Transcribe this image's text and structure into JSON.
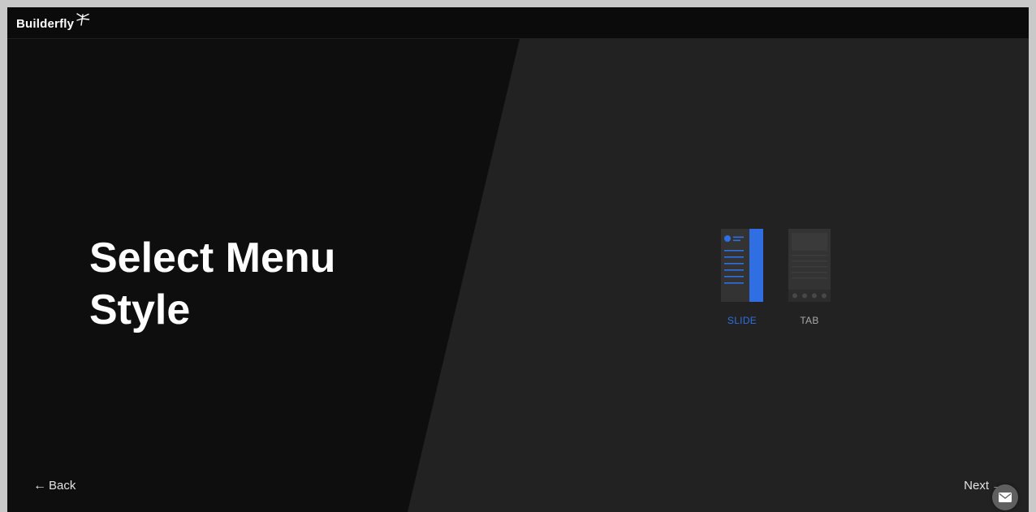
{
  "header": {
    "logo_text": "Builderfly",
    "logo_icon": "dragonfly-icon"
  },
  "main": {
    "heading_line1": "Select Menu",
    "heading_line2": "Style",
    "options": [
      {
        "label": "SLIDE",
        "icon": "slide-menu-icon",
        "selected": true
      },
      {
        "label": "TAB",
        "icon": "tab-menu-icon",
        "selected": false
      }
    ]
  },
  "footer": {
    "back_label": "Back",
    "next_label": "Next",
    "back_icon": "arrow-left-icon",
    "next_icon": "arrow-right-icon"
  },
  "chat": {
    "icon": "envelope-icon"
  },
  "colors": {
    "accent": "#2f6fe3",
    "left_background": "#0e0e0e",
    "right_background": "#222222",
    "text": "#ffffff"
  }
}
